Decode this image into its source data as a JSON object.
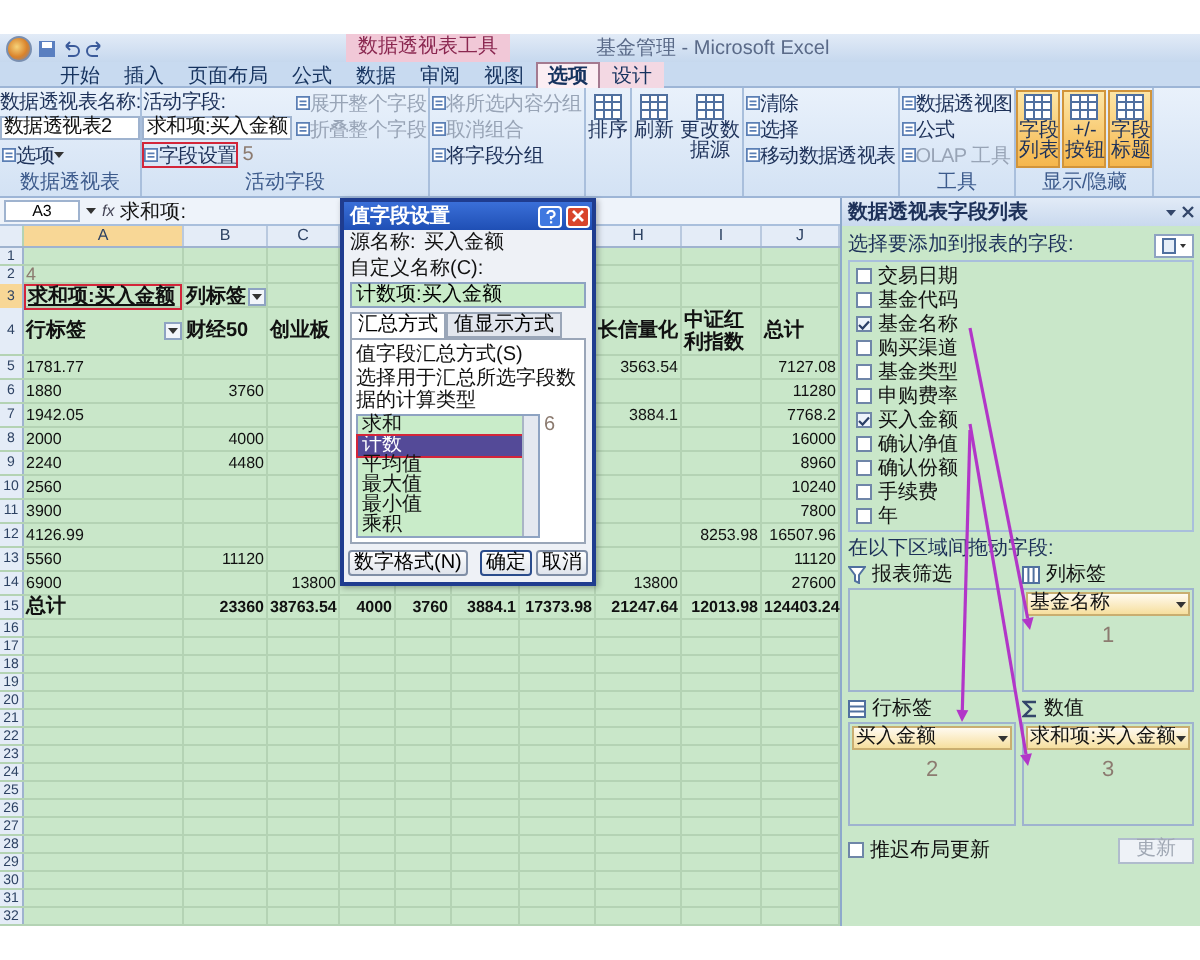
{
  "title_bar": {
    "context_label": "数据透视表工具",
    "title": "基金管理 - Microsoft Excel"
  },
  "tabs": [
    {
      "label": "开始",
      "selected": false,
      "context": false
    },
    {
      "label": "插入",
      "selected": false,
      "context": false
    },
    {
      "label": "页面布局",
      "selected": false,
      "context": false
    },
    {
      "label": "公式",
      "selected": false,
      "context": false
    },
    {
      "label": "数据",
      "selected": false,
      "context": false
    },
    {
      "label": "审阅",
      "selected": false,
      "context": false
    },
    {
      "label": "视图",
      "selected": false,
      "context": false
    },
    {
      "label": "选项",
      "selected": true,
      "context": true
    },
    {
      "label": "设计",
      "selected": false,
      "context": true
    }
  ],
  "ribbon": [
    {
      "label": "数据透视表",
      "columns": [
        [
          {
            "kind": "text",
            "label": "数据透视表名称:"
          },
          {
            "kind": "field",
            "label": "数据透视表2"
          },
          {
            "kind": "small",
            "label": "选项",
            "caret": true,
            "disabled": false,
            "marked": false
          }
        ]
      ]
    },
    {
      "label": "活动字段",
      "columns": [
        [
          {
            "kind": "text",
            "label": "活动字段:"
          },
          {
            "kind": "field",
            "label": "求和项:买入金额"
          },
          {
            "kind": "small",
            "label": "字段设置",
            "disabled": false,
            "marked": true,
            "note": "5"
          }
        ],
        [
          {
            "kind": "small",
            "label": "展开整个字段",
            "disabled": true,
            "marked": false
          },
          {
            "kind": "small",
            "label": "折叠整个字段",
            "disabled": true,
            "marked": false
          }
        ]
      ]
    },
    {
      "columns": [
        [
          {
            "kind": "small",
            "label": "将所选内容分组",
            "disabled": true,
            "marked": false
          },
          {
            "kind": "small",
            "label": "取消组合",
            "disabled": true,
            "marked": false
          },
          {
            "kind": "small",
            "label": "将字段分组",
            "disabled": false,
            "marked": false
          }
        ]
      ]
    },
    {
      "columns": [
        [
          {
            "kind": "big",
            "label": "排序",
            "on": false
          }
        ]
      ]
    },
    {
      "columns": [
        [
          {
            "kind": "big",
            "label": "刷新",
            "on": false
          }
        ],
        [
          {
            "kind": "big",
            "label": "更改数据源",
            "on": false
          }
        ]
      ]
    },
    {
      "columns": [
        [
          {
            "kind": "small",
            "label": "清除",
            "disabled": false,
            "marked": false
          },
          {
            "kind": "small",
            "label": "选择",
            "disabled": false,
            "marked": false
          },
          {
            "kind": "small",
            "label": "移动数据透视表",
            "disabled": false,
            "marked": false
          }
        ]
      ]
    },
    {
      "label": "工具",
      "columns": [
        [
          {
            "kind": "small",
            "label": "数据透视图",
            "disabled": false,
            "marked": false
          },
          {
            "kind": "small",
            "label": "公式",
            "disabled": false,
            "marked": false
          },
          {
            "kind": "small",
            "label": "OLAP 工具",
            "disabled": true,
            "marked": false
          }
        ]
      ]
    },
    {
      "label": "显示/隐藏",
      "columns": [
        [
          {
            "kind": "big",
            "label": "字段列表",
            "on": true
          }
        ],
        [
          {
            "kind": "big",
            "label": "+/- 按钮",
            "on": true
          }
        ],
        [
          {
            "kind": "big",
            "label": "字段标题",
            "on": true
          }
        ]
      ]
    }
  ],
  "formula_bar": {
    "name_box": "A3",
    "fx": "fx",
    "formula": "求和项:"
  },
  "sheet": {
    "column_headers": {
      "A": {
        "letter": "A",
        "active": true
      },
      "B": {
        "letter": "B",
        "active": false
      },
      "C": {
        "letter": "C",
        "active": false
      },
      "H": {
        "letter": "H",
        "active": false
      },
      "I": {
        "letter": "I",
        "active": false
      },
      "J": {
        "letter": "J",
        "active": false
      }
    },
    "rows": [
      {
        "n": "1",
        "kind": "empty",
        "active": false
      },
      {
        "n": "2",
        "kind": "note",
        "active": false,
        "cells": {
          "A": "4"
        }
      },
      {
        "n": "3",
        "kind": "label",
        "active": true,
        "marked": true,
        "cells": {
          "A": "求和项:买入金额",
          "B": {
            "text": "列标签",
            "dropdown": true
          }
        }
      },
      {
        "n": "4",
        "kind": "header",
        "active": false,
        "cells": {
          "A": {
            "text": "行标签",
            "dropdown": true
          },
          "B": "财经50",
          "C": "创业板",
          "H": "长信量化",
          "I": "中证红利指数",
          "J": "总计"
        }
      },
      {
        "n": "5",
        "kind": "data",
        "active": false,
        "cells": {
          "A": "1781.77",
          "H": "3563.54",
          "J": "7127.08"
        }
      },
      {
        "n": "6",
        "kind": "data",
        "active": false,
        "cells": {
          "A": "1880",
          "B": "3760",
          "J": "11280"
        }
      },
      {
        "n": "7",
        "kind": "data",
        "active": false,
        "cells": {
          "A": "1942.05",
          "H": "3884.1",
          "J": "7768.2"
        }
      },
      {
        "n": "8",
        "kind": "data",
        "active": false,
        "cells": {
          "A": "2000",
          "B": "4000",
          "J": "16000"
        }
      },
      {
        "n": "9",
        "kind": "data",
        "active": false,
        "cells": {
          "A": "2240",
          "B": "4480",
          "J": "8960"
        }
      },
      {
        "n": "10",
        "kind": "data",
        "active": false,
        "cells": {
          "A": "2560",
          "J": "10240"
        }
      },
      {
        "n": "11",
        "kind": "data",
        "active": false,
        "cells": {
          "A": "3900",
          "J": "7800"
        }
      },
      {
        "n": "12",
        "kind": "data",
        "active": false,
        "cells": {
          "A": "4126.99",
          "I": "8253.98",
          "J": "16507.96"
        }
      },
      {
        "n": "13",
        "kind": "data",
        "active": false,
        "cells": {
          "A": "5560",
          "B": "11120",
          "J": "11120"
        }
      },
      {
        "n": "14",
        "kind": "data",
        "active": false,
        "cells": {
          "A": "6900",
          "C": "13800",
          "H": "13800",
          "J": "27600"
        }
      },
      {
        "n": "15",
        "kind": "total",
        "active": false,
        "cells": {
          "A": "总计",
          "B": "23360",
          "C": "38763.54",
          "D": "4000",
          "E": "3760",
          "F": "3884.1",
          "G": "17373.98",
          "H": "21247.64",
          "I": "12013.98",
          "J": "124403.24"
        }
      },
      {
        "n": "16",
        "kind": "empty",
        "active": false
      },
      {
        "n": "17",
        "kind": "empty",
        "active": false
      },
      {
        "n": "18",
        "kind": "empty",
        "active": false
      },
      {
        "n": "19",
        "kind": "empty",
        "active": false
      },
      {
        "n": "20",
        "kind": "empty",
        "active": false
      },
      {
        "n": "21",
        "kind": "empty",
        "active": false
      },
      {
        "n": "22",
        "kind": "empty",
        "active": false
      },
      {
        "n": "23",
        "kind": "empty",
        "active": false
      },
      {
        "n": "24",
        "kind": "empty",
        "active": false
      },
      {
        "n": "25",
        "kind": "empty",
        "active": false
      },
      {
        "n": "26",
        "kind": "empty",
        "active": false
      },
      {
        "n": "27",
        "kind": "empty",
        "active": false
      },
      {
        "n": "28",
        "kind": "empty",
        "active": false
      },
      {
        "n": "29",
        "kind": "empty",
        "active": false
      },
      {
        "n": "30",
        "kind": "empty",
        "active": false
      },
      {
        "n": "31",
        "kind": "empty",
        "active": false
      },
      {
        "n": "32",
        "kind": "empty",
        "active": false
      }
    ]
  },
  "dialog": {
    "title": "值字段设置",
    "source_label": "源名称:",
    "source_value": "买入金额",
    "custom_label": "自定义名称(C):",
    "custom_value": "计数项:买入金额",
    "tabs": [
      {
        "label": "汇总方式",
        "selected": true
      },
      {
        "label": "值显示方式",
        "selected": false
      }
    ],
    "group_label": "值字段汇总方式(S)",
    "description": "选择用于汇总所选字段数据的计算类型",
    "items": [
      {
        "label": "求和",
        "selected": false
      },
      {
        "label": "计数",
        "selected": true
      },
      {
        "label": "平均值",
        "selected": false
      },
      {
        "label": "最大值",
        "selected": false
      },
      {
        "label": "最小值",
        "selected": false
      },
      {
        "label": "乘积",
        "selected": false
      }
    ],
    "note": "6",
    "buttons": [
      {
        "label": "数字格式(N)",
        "kind": "format"
      },
      {
        "label": "确定",
        "kind": "ok"
      },
      {
        "label": "取消",
        "kind": "cancel"
      }
    ]
  },
  "field_list": {
    "title": "数据透视表字段列表",
    "prompt": "选择要添加到报表的字段:",
    "fields": [
      {
        "label": "交易日期",
        "checked": false
      },
      {
        "label": "基金代码",
        "checked": false
      },
      {
        "label": "基金名称",
        "checked": true
      },
      {
        "label": "购买渠道",
        "checked": false
      },
      {
        "label": "基金类型",
        "checked": false
      },
      {
        "label": "申购费率",
        "checked": false
      },
      {
        "label": "买入金额",
        "checked": true
      },
      {
        "label": "确认净值",
        "checked": false
      },
      {
        "label": "确认份额",
        "checked": false
      },
      {
        "label": "手续费",
        "checked": false
      },
      {
        "label": "年",
        "checked": false
      }
    ],
    "areas_prompt": "在以下区域间拖动字段:",
    "areas": [
      {
        "kind": "filter",
        "label": "报表筛选"
      },
      {
        "kind": "column",
        "label": "列标签",
        "field": "基金名称",
        "note": "1"
      },
      {
        "kind": "row",
        "label": "行标签",
        "field": "买入金额",
        "note": "2"
      },
      {
        "kind": "value",
        "label": "数值",
        "field": "求和项:买入金额",
        "note": "3"
      }
    ],
    "defer_label": "推迟布局更新",
    "defer_checked": false,
    "update_button": {
      "label": "更新",
      "disabled": true
    }
  }
}
